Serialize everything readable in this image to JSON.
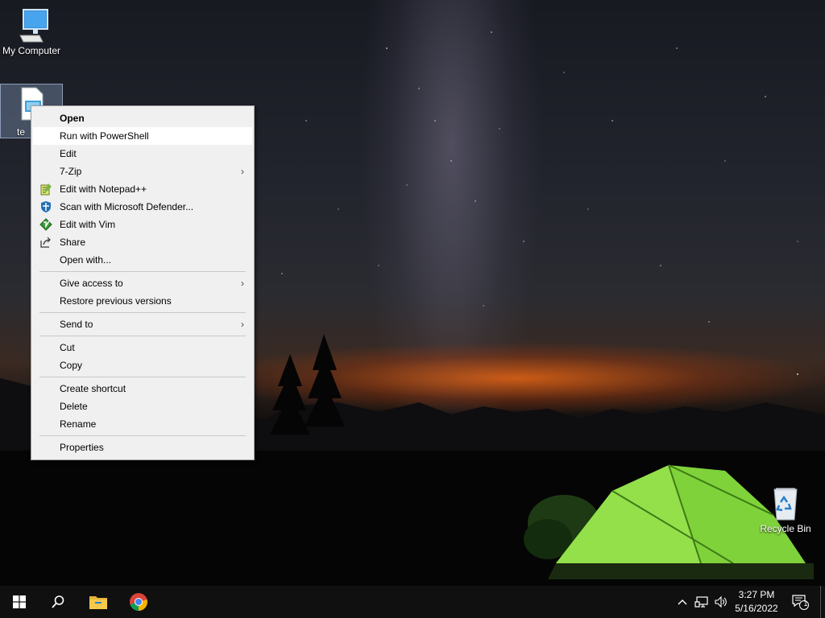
{
  "desktop": {
    "icons": [
      {
        "label": "My Computer",
        "icon": "computer-icon"
      },
      {
        "label": "te",
        "icon": "script-file-icon"
      },
      {
        "label": "Recycle Bin",
        "icon": "recycle-bin-icon"
      }
    ]
  },
  "context_menu": {
    "groups": [
      [
        {
          "label": "Open",
          "bold": true
        },
        {
          "label": "Run with PowerShell",
          "highlighted": true
        },
        {
          "label": "Edit"
        },
        {
          "label": "7-Zip",
          "submenu": true
        },
        {
          "label": "Edit with Notepad++",
          "icon": "notepadpp-icon"
        },
        {
          "label": "Scan with Microsoft Defender...",
          "icon": "defender-shield-icon"
        },
        {
          "label": "Edit with Vim",
          "icon": "vim-icon"
        },
        {
          "label": "Share",
          "icon": "share-icon"
        },
        {
          "label": "Open with..."
        }
      ],
      [
        {
          "label": "Give access to",
          "submenu": true
        },
        {
          "label": "Restore previous versions"
        }
      ],
      [
        {
          "label": "Send to",
          "submenu": true
        }
      ],
      [
        {
          "label": "Cut"
        },
        {
          "label": "Copy"
        }
      ],
      [
        {
          "label": "Create shortcut"
        },
        {
          "label": "Delete"
        },
        {
          "label": "Rename"
        }
      ],
      [
        {
          "label": "Properties"
        }
      ]
    ],
    "submenu_arrow": "›"
  },
  "taskbar": {
    "pinned": [
      "windows-start-icon",
      "search-icon",
      "file-explorer-icon",
      "chrome-icon"
    ],
    "tray": [
      "chevron-up-icon",
      "network-icon",
      "volume-icon"
    ],
    "clock": {
      "time": "3:27 PM",
      "date": "5/16/2022"
    },
    "notifications_count": "1"
  },
  "colors": {
    "menu_bg": "#f0f0f0",
    "menu_highlight": "#ffffff",
    "taskbar_bg": "#101010",
    "tent_green": "#7fd23a"
  }
}
